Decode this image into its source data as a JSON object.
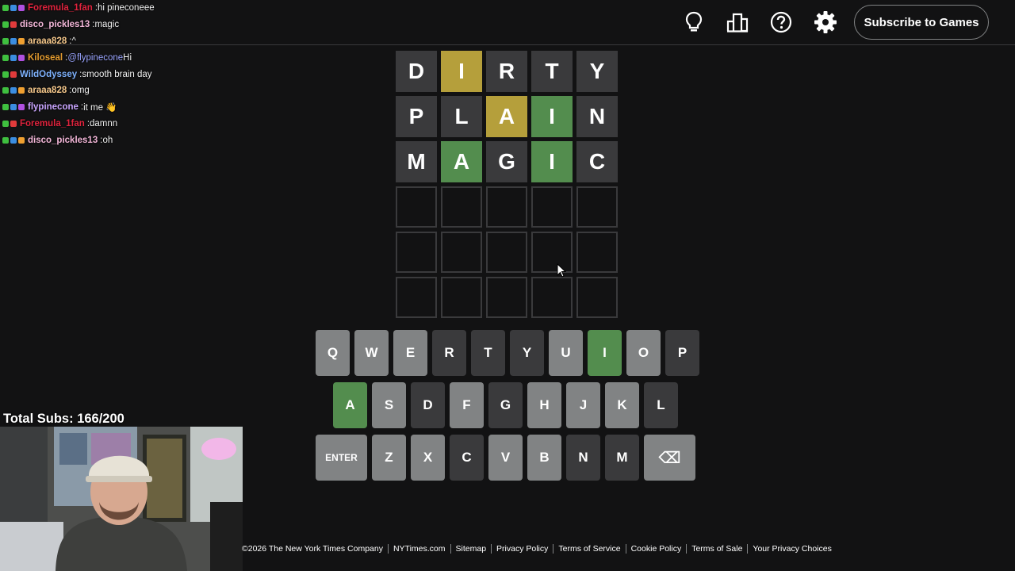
{
  "header": {
    "subscribe_label": "Subscribe to Games",
    "icons": [
      "hint-icon",
      "stats-icon",
      "help-icon",
      "settings-icon"
    ]
  },
  "chat": [
    {
      "user": "Foremula_1fan",
      "color": "#e0233d",
      "text": "hi pineconeee"
    },
    {
      "user": "disco_pickles13",
      "color": "#f4b7d9",
      "text": "magic"
    },
    {
      "user": "araaa828",
      "color": "#f7c98c",
      "text": "^"
    },
    {
      "user": "Kiloseal",
      "color": "#e39b2f",
      "mention": "@flypinecone",
      "text": "Hi"
    },
    {
      "user": "WildOdyssey",
      "color": "#7fb3ff",
      "text": "smooth brain day"
    },
    {
      "user": "araaa828",
      "color": "#f7c98c",
      "text": "omg"
    },
    {
      "user": "flypinecone",
      "color": "#c9a5ff",
      "text": "it me 👋"
    },
    {
      "user": "Foremula_1fan",
      "color": "#e0233d",
      "text": "damnn"
    },
    {
      "user": "disco_pickles13",
      "color": "#f4b7d9",
      "text": "oh"
    }
  ],
  "board": [
    [
      {
        "l": "D",
        "s": "absent"
      },
      {
        "l": "I",
        "s": "present"
      },
      {
        "l": "R",
        "s": "absent"
      },
      {
        "l": "T",
        "s": "absent"
      },
      {
        "l": "Y",
        "s": "absent"
      }
    ],
    [
      {
        "l": "P",
        "s": "absent"
      },
      {
        "l": "L",
        "s": "absent"
      },
      {
        "l": "A",
        "s": "present"
      },
      {
        "l": "I",
        "s": "correct"
      },
      {
        "l": "N",
        "s": "absent"
      }
    ],
    [
      {
        "l": "M",
        "s": "absent"
      },
      {
        "l": "A",
        "s": "correct"
      },
      {
        "l": "G",
        "s": "absent"
      },
      {
        "l": "I",
        "s": "correct"
      },
      {
        "l": "C",
        "s": "absent"
      }
    ],
    [
      {
        "l": "",
        "s": "empty"
      },
      {
        "l": "",
        "s": "empty"
      },
      {
        "l": "",
        "s": "empty"
      },
      {
        "l": "",
        "s": "empty"
      },
      {
        "l": "",
        "s": "empty"
      }
    ],
    [
      {
        "l": "",
        "s": "empty"
      },
      {
        "l": "",
        "s": "empty"
      },
      {
        "l": "",
        "s": "empty"
      },
      {
        "l": "",
        "s": "empty"
      },
      {
        "l": "",
        "s": "empty"
      }
    ],
    [
      {
        "l": "",
        "s": "empty"
      },
      {
        "l": "",
        "s": "empty"
      },
      {
        "l": "",
        "s": "empty"
      },
      {
        "l": "",
        "s": "empty"
      },
      {
        "l": "",
        "s": "empty"
      }
    ]
  ],
  "keyboard": [
    [
      {
        "k": "Q",
        "s": "unused"
      },
      {
        "k": "W",
        "s": "unused"
      },
      {
        "k": "E",
        "s": "unused"
      },
      {
        "k": "R",
        "s": "absent"
      },
      {
        "k": "T",
        "s": "absent"
      },
      {
        "k": "Y",
        "s": "absent"
      },
      {
        "k": "U",
        "s": "unused"
      },
      {
        "k": "I",
        "s": "correct"
      },
      {
        "k": "O",
        "s": "unused"
      },
      {
        "k": "P",
        "s": "absent"
      }
    ],
    [
      {
        "k": "A",
        "s": "correct"
      },
      {
        "k": "S",
        "s": "unused"
      },
      {
        "k": "D",
        "s": "absent"
      },
      {
        "k": "F",
        "s": "unused"
      },
      {
        "k": "G",
        "s": "absent"
      },
      {
        "k": "H",
        "s": "unused"
      },
      {
        "k": "J",
        "s": "unused"
      },
      {
        "k": "K",
        "s": "unused"
      },
      {
        "k": "L",
        "s": "absent"
      }
    ],
    [
      {
        "k": "ENTER",
        "s": "unused",
        "wide": true
      },
      {
        "k": "Z",
        "s": "unused"
      },
      {
        "k": "X",
        "s": "unused"
      },
      {
        "k": "C",
        "s": "absent"
      },
      {
        "k": "V",
        "s": "unused"
      },
      {
        "k": "B",
        "s": "unused"
      },
      {
        "k": "N",
        "s": "absent"
      },
      {
        "k": "M",
        "s": "absent"
      },
      {
        "k": "⌫",
        "s": "unused",
        "wide": true,
        "name": "backspace-key"
      }
    ]
  ],
  "overlay": {
    "total_subs": "Total Subs: 166/200"
  },
  "footer": [
    "©2026 The New York Times Company",
    "NYTimes.com",
    "Sitemap",
    "Privacy Policy",
    "Terms of Service",
    "Cookie Policy",
    "Terms of Sale",
    "Your Privacy Choices"
  ],
  "colors": {
    "absent": "#3a3a3c",
    "present": "#b59f3b",
    "correct": "#538d4e",
    "unused": "#818384",
    "background": "#121213"
  }
}
